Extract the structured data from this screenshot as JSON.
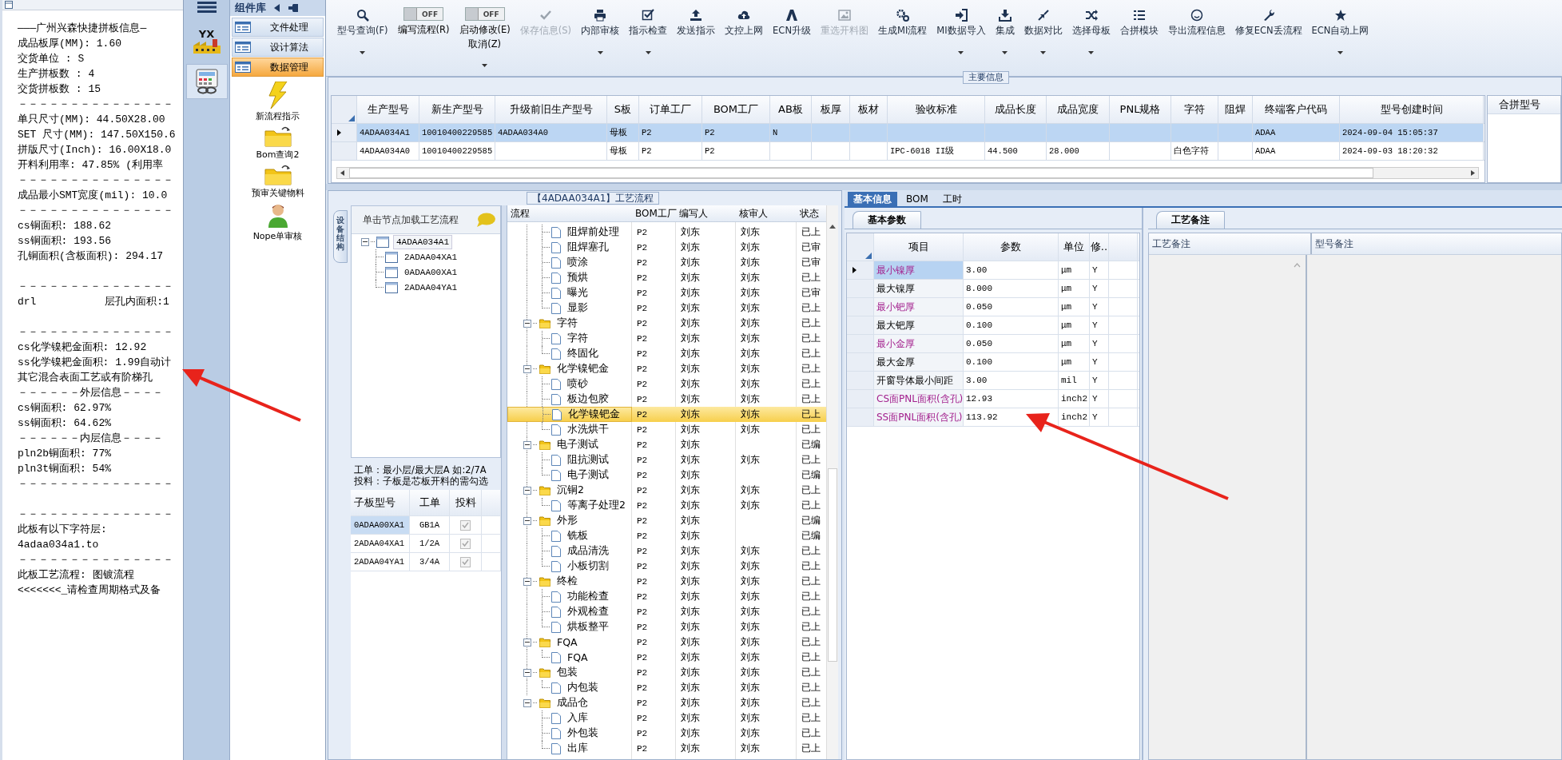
{
  "report": {
    "blocks": [
      [
        "———广州兴森快捷拼板信息—",
        "成品板厚(MM): 1.60",
        "交货单位 : S",
        "生产拼板数 : 4",
        "交货拼板数 : 15",
        "－－－－－－－－－－－－－－－",
        "单只尺寸(MM): 44.50X28.00",
        "SET 尺寸(MM): 147.50X150.6",
        "拼版尺寸(Inch): 16.00X18.0",
        "开料利用率: 47.85% (利用率",
        "－－－－－－－－－－－－－－－",
        "成品最小SMT宽度(mil): 10.0",
        "－－－－－－－－－－－－－－－",
        "cs铜面积: 188.62",
        "ss铜面积: 193.56",
        "孔铜面积(含板面积): 294.17"
      ],
      [
        "－－－－－－－－－－－－－－－",
        "drl           层孔内面积:1"
      ],
      [
        "－－－－－－－－－－－－－－－",
        "cs化学镍耙金面积: 12.92",
        "ss化学镍耙金面积: 1.99自动计",
        "其它混合表面工艺或有阶梯孔",
        "－－－－－－外层信息－－－－",
        "cs铜面积: 62.97%",
        "ss铜面积: 64.62%",
        "－－－－－－内层信息－－－－",
        "pln2b铜面积: 77%",
        "pln3t铜面积: 54%",
        "－－－－－－－－－－－－－－－"
      ],
      [
        "－－－－－－－－－－－－－－－",
        "此板有以下字符层:",
        "4adaa034a1.to",
        "－－－－－－－－－－－－－－－",
        "此板工艺流程: 图镀流程",
        "<<<<<<<_请检查周期格式及备"
      ]
    ]
  },
  "icon_bar": {
    "items": [
      {
        "kind": "logo",
        "text": "YX",
        "selected": false
      },
      {
        "kind": "calculator",
        "selected": true
      }
    ]
  },
  "sidebar": {
    "title": "组件库",
    "nav": [
      {
        "label": "文件处理",
        "selected": false
      },
      {
        "label": "设计算法",
        "selected": false
      },
      {
        "label": "数据管理",
        "selected": true
      }
    ],
    "items": [
      {
        "kind": "lightning",
        "label": "新流程指示"
      },
      {
        "kind": "folder",
        "label": "Bom查询2"
      },
      {
        "kind": "folder",
        "label": "预审关键物料"
      },
      {
        "kind": "user",
        "label": "Nope单审核"
      }
    ]
  },
  "toolbar": [
    {
      "kind": "search",
      "label": "型号查询(F)",
      "disabled": false,
      "dropdown": true
    },
    {
      "kind": "toggle",
      "label": "编写流程(R)",
      "on": false,
      "toggle_text": "OFF"
    },
    {
      "kind": "toggle",
      "label": "启动修改(E)",
      "sublabel": "取消(Z)",
      "on": false,
      "toggle_text": "OFF",
      "dropdown": true
    },
    {
      "kind": "check",
      "label": "保存信息(S)",
      "disabled": true,
      "dropdown": false
    },
    {
      "kind": "printer",
      "label": "内部审核",
      "disabled": false,
      "dropdown": true
    },
    {
      "kind": "checkbox",
      "label": "指示检查",
      "disabled": false,
      "dropdown": true
    },
    {
      "kind": "upload",
      "label": "发送指示",
      "disabled": false,
      "dropdown": false
    },
    {
      "kind": "cloud",
      "label": "文控上网",
      "disabled": false,
      "dropdown": false
    },
    {
      "kind": "triangle",
      "label": "ECN升级",
      "disabled": false,
      "dropdown": false
    },
    {
      "kind": "image",
      "label": "重选开料图",
      "disabled": true,
      "dropdown": false
    },
    {
      "kind": "gears",
      "label": "生成MI流程",
      "disabled": false,
      "dropdown": false
    },
    {
      "kind": "signin",
      "label": "MI数据导入",
      "disabled": false,
      "dropdown": true
    },
    {
      "kind": "download",
      "label": "集成",
      "disabled": false,
      "dropdown": true
    },
    {
      "kind": "compress",
      "label": "数据对比",
      "disabled": false,
      "dropdown": true
    },
    {
      "kind": "shuffle",
      "label": "选择母板",
      "disabled": false,
      "dropdown": true
    },
    {
      "kind": "list",
      "label": "合拼模块",
      "disabled": false,
      "dropdown": false
    },
    {
      "kind": "smile",
      "label": "导出流程信息",
      "disabled": false,
      "dropdown": false
    },
    {
      "kind": "wrench",
      "label": "修复ECN丢流程",
      "disabled": false,
      "dropdown": false
    },
    {
      "kind": "star",
      "label": "ECN自动上网",
      "disabled": false,
      "dropdown": true
    }
  ],
  "main_info": {
    "title": "主要信息",
    "side_column": "合拼型号",
    "columns": [
      "生产型号",
      "新生产型号",
      "升级前旧生产型号",
      "S板",
      "订单工厂",
      "BOM工厂",
      "AB板",
      "板厚",
      "板材",
      "验收标准",
      "成品长度",
      "成品宽度",
      "PNL规格",
      "字符",
      "阻焊",
      "终端客户代码",
      "型号创建时间"
    ],
    "rows": [
      {
        "selected": true,
        "cells": [
          "4ADAA034A1",
          "10010400229585",
          "4ADAA034A0",
          "母板",
          "P2",
          "P2",
          "N",
          null,
          null,
          null,
          null,
          null,
          null,
          null,
          null,
          "ADAA",
          "2024-09-04 15:05:37"
        ]
      },
      {
        "selected": false,
        "cells": [
          "4ADAA034A0",
          "10010400229585",
          null,
          "母板",
          "P2",
          "P2",
          null,
          null,
          null,
          "IPC-6018 II级",
          "44.500",
          "28.000",
          null,
          "白色字符",
          null,
          "ADAA",
          "2024-09-03 18:20:32"
        ]
      }
    ]
  },
  "process_panel": {
    "title": "【4ADAA034A1】工艺流程",
    "side_tab": "设备结构",
    "tree_header": "单击节点加载工艺流程",
    "tree": [
      {
        "label": "4ADAA034A1",
        "expanded": true,
        "selected": true,
        "children": [
          {
            "label": "2ADAA04XA1",
            "selected": false
          },
          {
            "label": "0ADAA00XA1",
            "selected": false
          },
          {
            "label": "2ADAA04YA1",
            "selected": false
          }
        ]
      }
    ],
    "notes": [
      "工单：最小层/最大层A 如:2/7A",
      "投料：子板是芯板开料的需勾选"
    ],
    "sub_boards": {
      "columns": [
        "子板型号",
        "工单",
        "投料"
      ],
      "rows": [
        {
          "cells": [
            "0ADAA00XA1",
            "GB1A"
          ],
          "checked": true,
          "disabled": true,
          "selected": true
        },
        {
          "cells": [
            "2ADAA04XA1",
            "1/2A"
          ],
          "checked": true,
          "disabled": true,
          "selected": false
        },
        {
          "cells": [
            "2ADAA04YA1",
            "3/4A"
          ],
          "checked": true,
          "disabled": true,
          "selected": false
        }
      ]
    },
    "flow": {
      "columns": [
        "流程",
        "BOM工厂",
        "编写人",
        "核审人",
        "状态"
      ],
      "leading_steps": [
        {
          "name": "阻焊前处理",
          "bom": "P2",
          "writer": "刘东",
          "reviewer": "刘东",
          "status": "已上",
          "selected": false
        },
        {
          "name": "阻焊塞孔",
          "bom": "P2",
          "writer": "刘东",
          "reviewer": "刘东",
          "status": "已审",
          "selected": false
        },
        {
          "name": "喷涂",
          "bom": "P2",
          "writer": "刘东",
          "reviewer": "刘东",
          "status": "已审",
          "selected": false
        },
        {
          "name": "预烘",
          "bom": "P2",
          "writer": "刘东",
          "reviewer": "刘东",
          "status": "已上",
          "selected": false
        },
        {
          "name": "曝光",
          "bom": "P2",
          "writer": "刘东",
          "reviewer": "刘东",
          "status": "已审",
          "selected": false
        },
        {
          "name": "显影",
          "bom": "P2",
          "writer": "刘东",
          "reviewer": "刘东",
          "status": "已上",
          "selected": false
        }
      ],
      "groups": [
        {
          "name": "字符",
          "bom": "P2",
          "writer": "刘东",
          "reviewer": "刘东",
          "status": "已上",
          "expanded": true,
          "selected": false,
          "children": [
            {
              "name": "字符",
              "bom": "P2",
              "writer": "刘东",
              "reviewer": "刘东",
              "status": "已上",
              "selected": false
            },
            {
              "name": "终固化",
              "bom": "P2",
              "writer": "刘东",
              "reviewer": "刘东",
              "status": "已上",
              "selected": false
            }
          ]
        },
        {
          "name": "化学镍钯金",
          "bom": "P2",
          "writer": "刘东",
          "reviewer": "刘东",
          "status": "已上",
          "expanded": true,
          "selected": false,
          "children": [
            {
              "name": "喷砂",
              "bom": "P2",
              "writer": "刘东",
              "reviewer": "刘东",
              "status": "已上",
              "selected": false
            },
            {
              "name": "板边包胶",
              "bom": "P2",
              "writer": "刘东",
              "reviewer": "刘东",
              "status": "已上",
              "selected": false
            },
            {
              "name": "化学镍钯金",
              "bom": "P2",
              "writer": "刘东",
              "reviewer": "刘东",
              "status": "已上",
              "selected": true
            },
            {
              "name": "水洗烘干",
              "bom": "P2",
              "writer": "刘东",
              "reviewer": "刘东",
              "status": "已上",
              "selected": false
            }
          ]
        },
        {
          "name": "电子测试",
          "bom": "P2",
          "writer": "刘东",
          "status": "已编",
          "expanded": true,
          "selected": false,
          "children": [
            {
              "name": "阻抗测试",
              "bom": "P2",
              "writer": "刘东",
              "reviewer": "刘东",
              "status": "已上",
              "selected": false
            },
            {
              "name": "电子测试",
              "bom": "P2",
              "writer": "刘东",
              "status": "已编",
              "selected": false
            }
          ]
        },
        {
          "name": "沉铜2",
          "bom": "P2",
          "writer": "刘东",
          "reviewer": "刘东",
          "status": "已上",
          "expanded": true,
          "selected": false,
          "children": [
            {
              "name": "等离子处理2",
              "bom": "P2",
              "writer": "刘东",
              "reviewer": "刘东",
              "status": "已上",
              "selected": false
            }
          ]
        },
        {
          "name": "外形",
          "bom": "P2",
          "writer": "刘东",
          "status": "已编",
          "expanded": true,
          "selected": false,
          "children": [
            {
              "name": "铣板",
              "bom": "P2",
              "writer": "刘东",
              "status": "已编",
              "selected": false
            },
            {
              "name": "成品清洗",
              "bom": "P2",
              "writer": "刘东",
              "reviewer": "刘东",
              "status": "已上",
              "selected": false
            },
            {
              "name": "小板切割",
              "bom": "P2",
              "writer": "刘东",
              "reviewer": "刘东",
              "status": "已上",
              "selected": false
            }
          ]
        },
        {
          "name": "终检",
          "bom": "P2",
          "writer": "刘东",
          "reviewer": "刘东",
          "status": "已上",
          "expanded": true,
          "selected": false,
          "children": [
            {
              "name": "功能检查",
              "bom": "P2",
              "writer": "刘东",
              "reviewer": "刘东",
              "status": "已上",
              "selected": false
            },
            {
              "name": "外观检查",
              "bom": "P2",
              "writer": "刘东",
              "reviewer": "刘东",
              "status": "已上",
              "selected": false
            },
            {
              "name": "烘板整平",
              "bom": "P2",
              "writer": "刘东",
              "reviewer": "刘东",
              "status": "已上",
              "selected": false
            }
          ]
        },
        {
          "name": "FQA",
          "bom": "P2",
          "writer": "刘东",
          "reviewer": "刘东",
          "status": "已上",
          "expanded": true,
          "selected": false,
          "children": [
            {
              "name": "FQA",
              "bom": "P2",
              "writer": "刘东",
              "reviewer": "刘东",
              "status": "已上",
              "selected": false
            }
          ]
        },
        {
          "name": "包装",
          "bom": "P2",
          "writer": "刘东",
          "reviewer": "刘东",
          "status": "已上",
          "expanded": true,
          "selected": false,
          "children": [
            {
              "name": "内包装",
              "bom": "P2",
              "writer": "刘东",
              "reviewer": "刘东",
              "status": "已上",
              "selected": false
            }
          ]
        },
        {
          "name": "成品仓",
          "bom": "P2",
          "writer": "刘东",
          "reviewer": "刘东",
          "status": "已上",
          "expanded": true,
          "selected": false,
          "children": [
            {
              "name": "入库",
              "bom": "P2",
              "writer": "刘东",
              "reviewer": "刘东",
              "status": "已上",
              "selected": false
            },
            {
              "name": "外包装",
              "bom": "P2",
              "writer": "刘东",
              "reviewer": "刘东",
              "status": "已上",
              "selected": false
            },
            {
              "name": "出库",
              "bom": "P2",
              "writer": "刘东",
              "reviewer": "刘东",
              "status": "已上",
              "selected": false
            }
          ]
        }
      ]
    }
  },
  "info_panel": {
    "tabs": [
      {
        "label": "基本信息",
        "selected": true
      },
      {
        "label": "BOM",
        "selected": false
      },
      {
        "label": "工时",
        "selected": false
      }
    ],
    "params": {
      "tab": "基本参数",
      "columns": [
        "项目",
        "参数",
        "单位",
        "修.."
      ],
      "rows": [
        {
          "item": "最小镍厚",
          "value": "3.00",
          "unit": "μm",
          "flag": "Y",
          "highlight": true,
          "selected": true
        },
        {
          "item": "最大镍厚",
          "value": "8.000",
          "unit": "μm",
          "flag": "Y",
          "highlight": false,
          "selected": false
        },
        {
          "item": "最小钯厚",
          "value": "0.050",
          "unit": "μm",
          "flag": "Y",
          "highlight": true,
          "selected": false
        },
        {
          "item": "最大钯厚",
          "value": "0.100",
          "unit": "μm",
          "flag": "Y",
          "highlight": false,
          "selected": false
        },
        {
          "item": "最小金厚",
          "value": "0.050",
          "unit": "μm",
          "flag": "Y",
          "highlight": true,
          "selected": false
        },
        {
          "item": "最大金厚",
          "value": "0.100",
          "unit": "μm",
          "flag": "Y",
          "highlight": false,
          "selected": false
        },
        {
          "item": "开窗导体最小间距",
          "value": "3.00",
          "unit": "mil",
          "flag": "Y",
          "highlight": false,
          "selected": false
        },
        {
          "item": "CS面PNL面积(含孔)",
          "value": "12.93",
          "unit": "inch2",
          "flag": "Y",
          "highlight": true,
          "selected": false
        },
        {
          "item": "SS面PNL面积(含孔)",
          "value": "113.92",
          "unit": "inch2",
          "flag": "Y",
          "highlight": true,
          "selected": false
        }
      ]
    },
    "notes": {
      "tab": "工艺备注",
      "columns": [
        "工艺备注",
        "型号备注"
      ]
    }
  }
}
